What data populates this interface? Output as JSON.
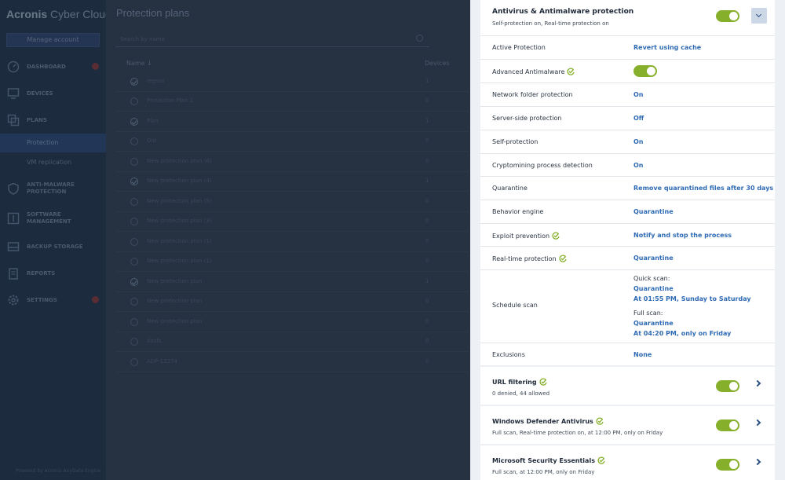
{
  "app": {
    "logo_brand": "Acronis",
    "logo_product": " Cyber Cloud",
    "manage_account": "Manage account",
    "footer_link": "Powered by Acronis AnyData Engine"
  },
  "sidebar": {
    "items": [
      {
        "label": "DASHBOARD",
        "icon": "dashboard-icon",
        "badge": true
      },
      {
        "label": "DEVICES",
        "icon": "monitor-icon",
        "badge": false
      },
      {
        "label": "PLANS",
        "icon": "plans-icon",
        "badge": false
      },
      {
        "label": "ANTI-MALWARE PROTECTION",
        "icon": "shield-icon",
        "badge": false
      },
      {
        "label": "SOFTWARE MANAGEMENT",
        "icon": "software-icon",
        "badge": false
      },
      {
        "label": "BACKUP STORAGE",
        "icon": "storage-icon",
        "badge": false
      },
      {
        "label": "REPORTS",
        "icon": "reports-icon",
        "badge": false
      },
      {
        "label": "SETTINGS",
        "icon": "gear-icon",
        "badge": true
      }
    ],
    "sub_items": [
      {
        "label": "Protection",
        "active": true
      },
      {
        "label": "VM replication",
        "active": false
      }
    ]
  },
  "plans_list": {
    "title": "Protection plans",
    "search_placeholder": "Search by name",
    "col_name": "Name ↓",
    "col_devices": "Devices",
    "rows": [
      {
        "name": "regsss",
        "count": "1",
        "checked": true
      },
      {
        "name": "Protection Plan 1",
        "count": "0",
        "checked": false
      },
      {
        "name": "Plan",
        "count": "1",
        "checked": true
      },
      {
        "name": "Old",
        "count": "0",
        "checked": false
      },
      {
        "name": "New protection plan (6)",
        "count": "0",
        "checked": false
      },
      {
        "name": "New protection plan (4)",
        "count": "1",
        "checked": true
      },
      {
        "name": "New protection plan (5)",
        "count": "0",
        "checked": false
      },
      {
        "name": "New protection plan (3)",
        "count": "0",
        "checked": false
      },
      {
        "name": "New protection plan (1)",
        "count": "0",
        "checked": false
      },
      {
        "name": "New protection plan (1)",
        "count": "0",
        "checked": false
      },
      {
        "name": "New protection plan",
        "count": "1",
        "checked": true
      },
      {
        "name": "New protection plan",
        "count": "0",
        "checked": false
      },
      {
        "name": "New protection plan",
        "count": "0",
        "checked": false
      },
      {
        "name": "dasfs",
        "count": "0",
        "checked": false
      },
      {
        "name": "ADP-13274",
        "count": "0",
        "checked": false
      }
    ]
  },
  "panel": {
    "main": {
      "title": "Antivirus & Antimalware protection",
      "subtitle": "Self-protection on, Real-time protection on",
      "enabled": true
    },
    "settings": [
      {
        "label": "Active Protection",
        "value": "Revert using cache",
        "check": false
      },
      {
        "label": "Advanced Antimalware",
        "value": "",
        "toggle": true,
        "check": true
      },
      {
        "label": "Network folder protection",
        "value": "On",
        "check": false
      },
      {
        "label": "Server-side protection",
        "value": "Off",
        "check": false
      },
      {
        "label": "Self-protection",
        "value": "On",
        "check": false
      },
      {
        "label": "Cryptomining process detection",
        "value": "On",
        "check": false
      },
      {
        "label": "Quarantine",
        "value": "Remove quarantined files after 30 days",
        "check": false
      },
      {
        "label": "Behavior engine",
        "value": "Quarantine",
        "check": false
      },
      {
        "label": "Exploit prevention",
        "value": "Notify and stop the process",
        "check": true
      },
      {
        "label": "Real-time protection",
        "value": "Quarantine",
        "check": true
      }
    ],
    "schedule": {
      "label": "Schedule scan",
      "quick_caption": "Quick scan:",
      "quick_action": "Quarantine",
      "quick_time": "At 01:55 PM, Sunday to Saturday",
      "full_caption": "Full scan:",
      "full_action": "Quarantine",
      "full_time": "At 04:20 PM, only on Friday"
    },
    "exclusions": {
      "label": "Exclusions",
      "value": "None"
    },
    "modules": [
      {
        "title": "URL filtering",
        "subtitle": "0 denied, 44 allowed",
        "enabled": true
      },
      {
        "title": "Windows Defender Antivirus",
        "subtitle": "Full scan, Real-time protection on, at 12:00 PM, only on Friday",
        "enabled": true
      },
      {
        "title": "Microsoft Security Essentials",
        "subtitle": "Full scan, at 12:00 PM, only on Friday",
        "enabled": true
      }
    ]
  },
  "colors": {
    "accent_green": "#86b02c",
    "link_blue": "#2f6bb4",
    "sidebar_bg": "#1d2b3f"
  }
}
